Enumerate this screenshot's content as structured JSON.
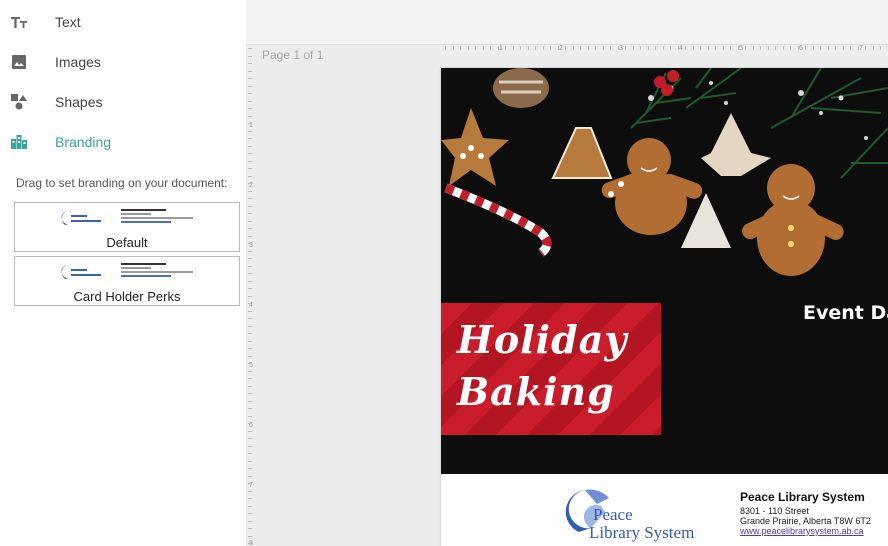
{
  "sidebar": {
    "items": [
      {
        "label": "Text",
        "icon": "text-icon"
      },
      {
        "label": "Images",
        "icon": "image-icon"
      },
      {
        "label": "Shapes",
        "icon": "shapes-icon"
      },
      {
        "label": "Branding",
        "icon": "branding-icon",
        "active": true
      }
    ],
    "hint": "Drag to set branding on your document:",
    "brandings": [
      {
        "label": "Default"
      },
      {
        "label": "Card Holder Perks"
      }
    ],
    "accent_color": "#3aa39a"
  },
  "canvas": {
    "page_indicator": "Page 1 of 1",
    "hruler_labels": [
      "1",
      "2",
      "3",
      "4",
      "5",
      "6",
      "7"
    ],
    "vruler_labels": [
      "1",
      "2",
      "3",
      "4",
      "5",
      "6",
      "7",
      "8"
    ]
  },
  "document": {
    "title_line1": "Holiday",
    "title_line2": "Baking",
    "event_date": "Event Da",
    "title_box_color": "#c91d2c",
    "logo_word1": "Peace",
    "logo_word2": "Library System",
    "org_name": "Peace Library System",
    "address_line1": "8301 - 110 Street",
    "address_line2": "Grande Prairie, Alberta T8W 6T2",
    "website": "www.peacelibrarysystem.ab.ca"
  }
}
